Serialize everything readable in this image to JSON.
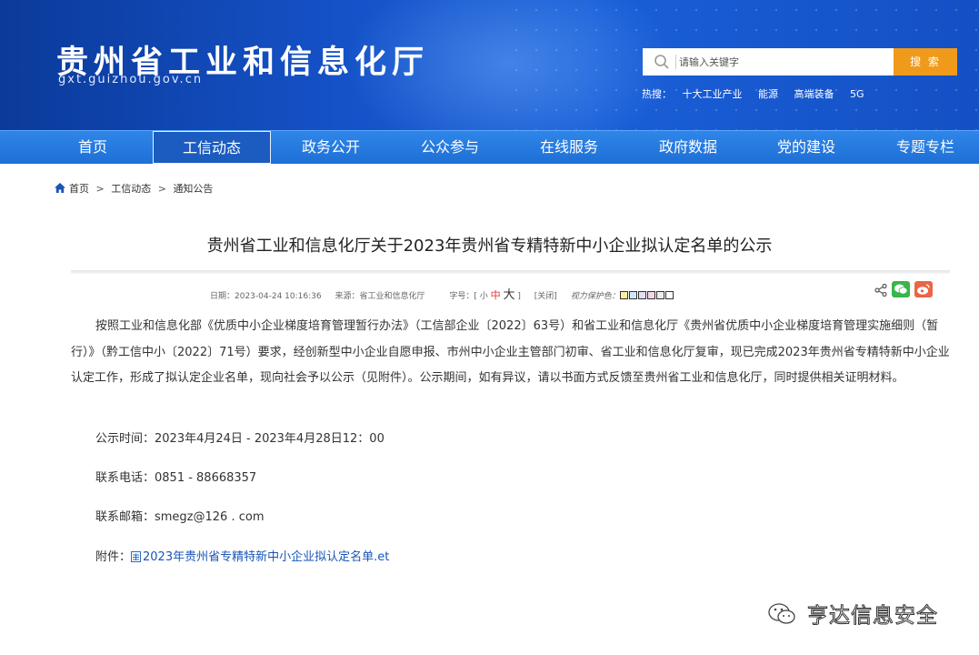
{
  "header": {
    "site_title": "贵州省工业和信息化厅",
    "site_domain": "gxt.guizhou.gov.cn",
    "search": {
      "placeholder": "请输入关键字",
      "button_label": "搜 索"
    },
    "hot": {
      "label": "热搜：",
      "items": [
        "十大工业产业",
        "能源",
        "高端装备",
        "5G"
      ]
    },
    "colors": {
      "banner": "#1552c8",
      "nav": "#2478e0",
      "search_button": "#f09a1c"
    }
  },
  "nav": {
    "items": [
      "首页",
      "工信动态",
      "政务公开",
      "公众参与",
      "在线服务",
      "政府数据",
      "党的建设",
      "专题专栏"
    ],
    "active": "工信动态"
  },
  "breadcrumb": {
    "home": "首页",
    "items": [
      "工信动态",
      "通知公告"
    ],
    "separator": ">"
  },
  "article": {
    "title": "贵州省工业和信息化厅关于2023年贵州省专精特新中小企业拟认定名单的公示",
    "meta": {
      "date": "日期：2023-04-24 10:16:36",
      "source": "来源：省工业和信息化厅",
      "fontsize_label": "字号：[",
      "small": "小",
      "medium": "中",
      "large": "大",
      "close_bracket": "]",
      "close": "[关闭]",
      "eye_protect": "视力保护色："
    },
    "eye_colors": [
      "#f9f0a0",
      "#cfe8f8",
      "#e0e0f0",
      "#f6d6e6",
      "#eeeeee",
      "#ffffff"
    ],
    "body": "按照工业和信息化部《优质中小企业梯度培育管理暂行办法》（工信部企业〔2022〕63号）和省工业和信息化厅《贵州省优质中小企业梯度培育管理实施细则（暂行）》（黔工信中小〔2022〕71号）要求，经创新型中小企业自愿申报、市州中小企业主管部门初审、省工业和信息化厅复审，现已完成2023年贵州省专精特新中小企业认定工作，形成了拟认定企业名单，现向社会予以公示（见附件）。公示期间，如有异议，请以书面方式反馈至贵州省工业和信息化厅，同时提供相关证明材料。",
    "period": "公示时间：2023年4月24日 - 2023年4月28日12：00",
    "phone": "联系电话：0851 - 88668357",
    "email": "联系邮箱：smegz@126 . com",
    "attachment_label": "附件：",
    "attachment_file": "2023年贵州省专精特新中小企业拟认定名单.et"
  },
  "watermark": {
    "text": "亨达信息安全",
    "icon": "wechat-logo-icon"
  }
}
